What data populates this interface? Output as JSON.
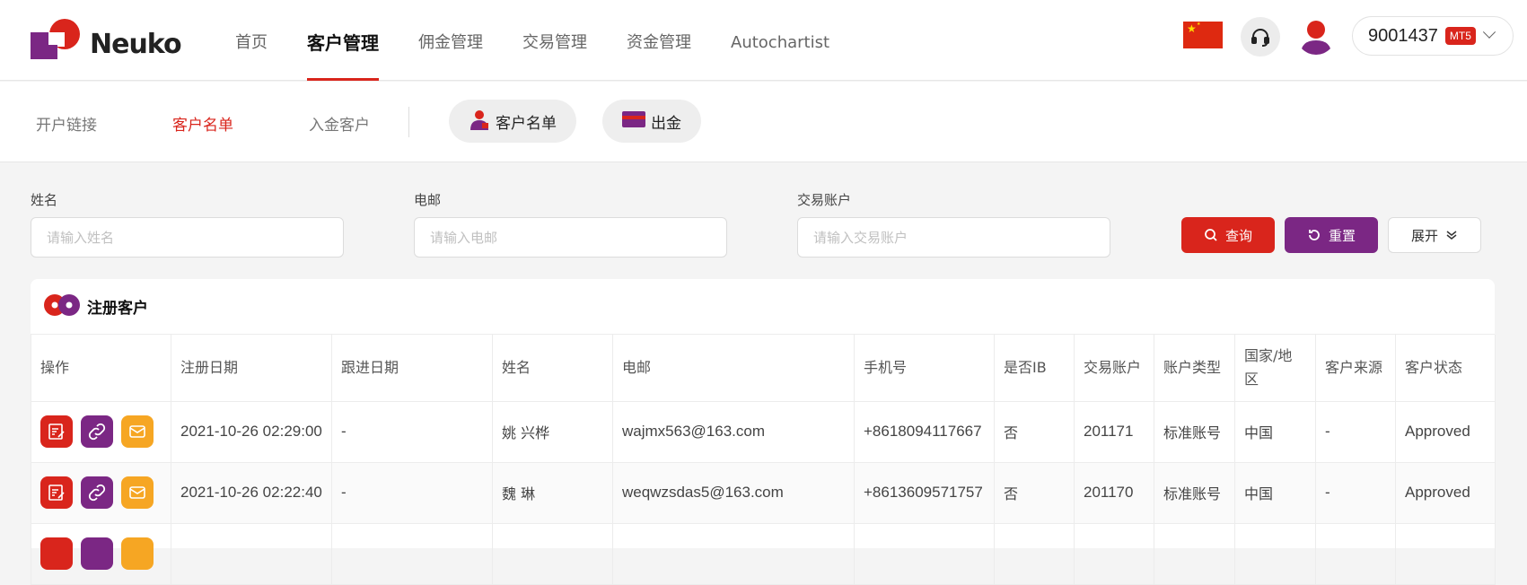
{
  "brand": {
    "name": "Neuko"
  },
  "nav": {
    "items": [
      {
        "label": "首页",
        "active": false
      },
      {
        "label": "客户管理",
        "active": true
      },
      {
        "label": "佣金管理",
        "active": false
      },
      {
        "label": "交易管理",
        "active": false
      },
      {
        "label": "资金管理",
        "active": false
      },
      {
        "label": "Autochartist",
        "active": false
      }
    ]
  },
  "header_right": {
    "flag_icon": "china-flag-icon",
    "support_icon": "headset-icon",
    "avatar_icon": "user-avatar-icon",
    "account_number": "9001437",
    "platform_badge": "MT5"
  },
  "subnav": {
    "items": [
      {
        "label": "开户链接",
        "active": false
      },
      {
        "label": "客户名单",
        "active": true
      },
      {
        "label": "入金客户",
        "active": false
      }
    ],
    "quick_buttons": [
      {
        "label": "客户名单",
        "icon": "client-list-icon"
      },
      {
        "label": "出金",
        "icon": "withdraw-card-icon"
      }
    ]
  },
  "filters": {
    "name": {
      "label": "姓名",
      "placeholder": "请输入姓名",
      "value": ""
    },
    "email": {
      "label": "电邮",
      "placeholder": "请输入电邮",
      "value": ""
    },
    "account": {
      "label": "交易账户",
      "placeholder": "请输入交易账户",
      "value": ""
    },
    "search_label": "查询",
    "reset_label": "重置",
    "expand_label": "展开"
  },
  "table": {
    "title": "注册客户",
    "columns": [
      "操作",
      "注册日期",
      "跟进日期",
      "姓名",
      "电邮",
      "手机号",
      "是否IB",
      "交易账户",
      "账户类型",
      "国家/地区",
      "客户来源",
      "客户状态"
    ],
    "rows": [
      {
        "reg_date": "2021-10-26 02:29:00",
        "follow_date": "-",
        "name": "姚 兴桦",
        "email": "wajmx563@163.com",
        "phone": "+8618094117667",
        "is_ib": "否",
        "account": "201171",
        "account_type": "标准账号",
        "country": "中国",
        "source": "-",
        "status": "Approved"
      },
      {
        "reg_date": "2021-10-26 02:22:40",
        "follow_date": "-",
        "name": "魏 琳",
        "email": "weqwzsdas5@163.com",
        "phone": "+8613609571757",
        "is_ib": "否",
        "account": "201170",
        "account_type": "标准账号",
        "country": "中国",
        "source": "-",
        "status": "Approved"
      },
      {
        "reg_date": "",
        "follow_date": "",
        "name": "",
        "email": "",
        "phone": "",
        "is_ib": "",
        "account": "",
        "account_type": "",
        "country": "",
        "source": "",
        "status": ""
      }
    ],
    "row_action_icons": [
      "edit-icon",
      "link-icon",
      "mail-icon"
    ]
  },
  "colors": {
    "brand_red": "#d9251c",
    "brand_purple": "#7b2784",
    "accent_orange": "#f6a623"
  }
}
